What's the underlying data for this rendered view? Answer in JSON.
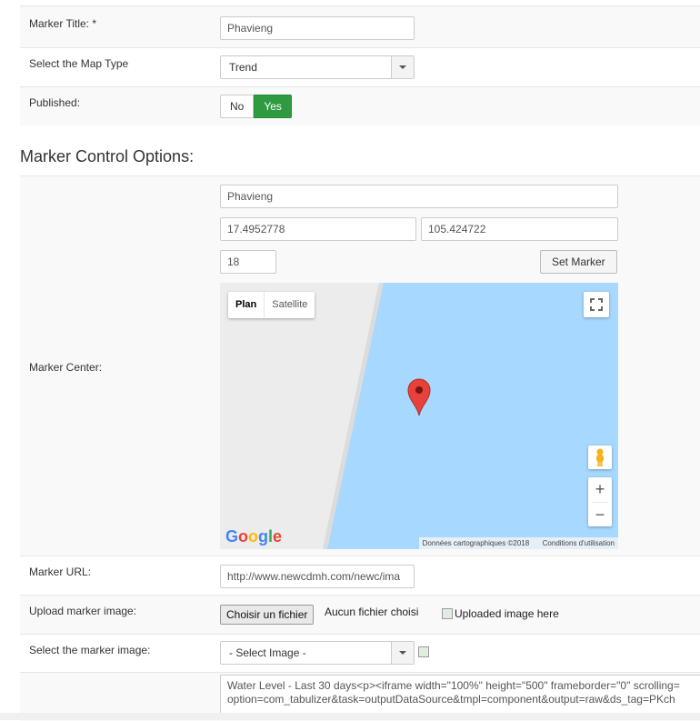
{
  "form": {
    "marker_title": {
      "label": "Marker Title: *",
      "value": "Phavieng"
    },
    "map_type": {
      "label": "Select the Map Type",
      "value": "Trend"
    },
    "published": {
      "label": "Published:",
      "no": "No",
      "yes": "Yes",
      "selected": "Yes"
    }
  },
  "section": {
    "title": "Marker Control Options:"
  },
  "marker_center": {
    "label": "Marker Center:",
    "name": "Phavieng",
    "latitude": "17.4952778",
    "longitude": "105.424722",
    "zoom": "18",
    "set_marker_label": "Set Marker"
  },
  "map": {
    "type_plan": "Plan",
    "type_satellite": "Satellite",
    "zoom_in": "+",
    "zoom_out": "−",
    "logo": [
      "G",
      "o",
      "o",
      "g",
      "l",
      "e"
    ],
    "data_credit": "Données cartographiques ©2018",
    "terms": "Conditions d'utilisation",
    "colors": {
      "water": "#a7d8ff",
      "land": "#ececec",
      "marker": "#e8413a"
    }
  },
  "marker_url": {
    "label": "Marker URL:",
    "value": "http://www.newcdmh.com/newc/ima"
  },
  "upload_image": {
    "label": "Upload marker image:",
    "button": "Choisir un fichier",
    "status": "Aucun fichier choisi",
    "preview_alt": "Uploaded image here"
  },
  "marker_image": {
    "label": "Select the marker image:",
    "value": "- Select Image -"
  },
  "description": {
    "line1": "Water Level - Last 30 days<p><iframe width=\"100%\" height=\"500\" frameborder=\"0\" scrolling=",
    "line2": "option=com_tabulizer&task=outputDataSource&tmpl=component&output=raw&ds_tag=PKch"
  }
}
